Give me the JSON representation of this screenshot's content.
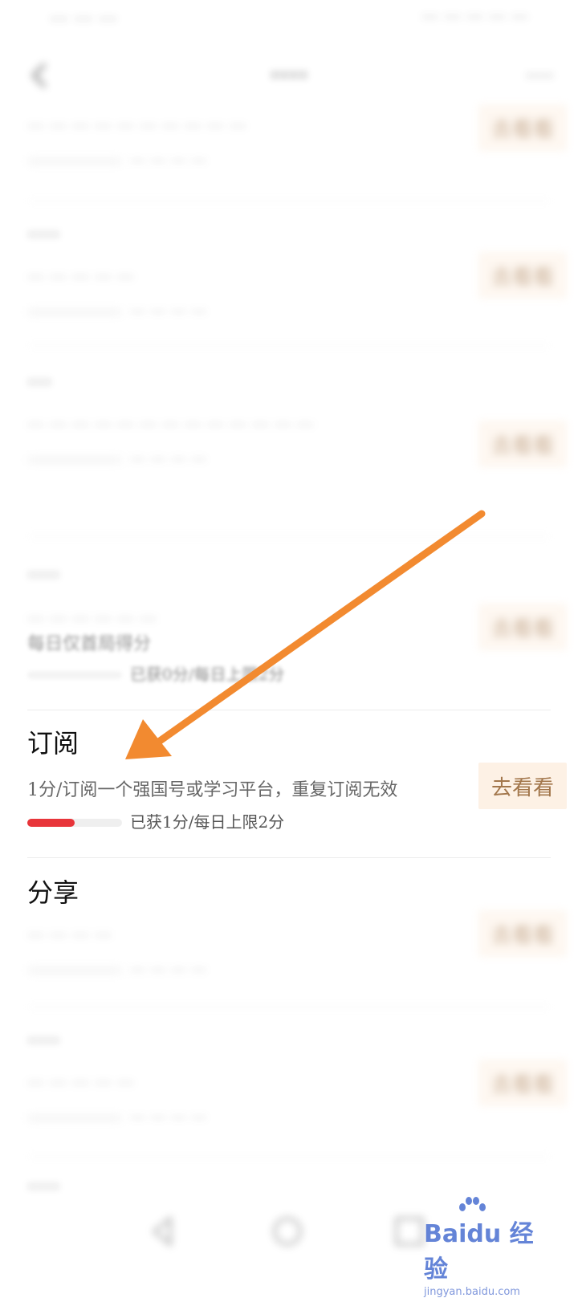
{
  "status_bar": {
    "left": "··· ··· ···",
    "right": "··· ··· ··· ··· ···"
  },
  "header": {
    "title": "····",
    "right_link": "····"
  },
  "tasks": [
    {
      "title": "",
      "desc": "··· ··· ··· ··· ··· ··· ··· ··· ··· ···",
      "progress_text": "··· ··· ··· ···",
      "button": "去看看",
      "progress": 0
    },
    {
      "title": "····",
      "desc": "··· ··· ··· ··· ···",
      "progress_text": "··· ··· ··· ···",
      "button": "去看看",
      "progress": 0
    },
    {
      "title": "···",
      "desc": "··· ··· ··· ··· ··· ··· ··· ··· ··· ··· ··· ··· ···",
      "progress_text": "··· ··· ··· ···",
      "button": "去看看",
      "progress": 0
    },
    {
      "title": "····",
      "desc_blur": "··· ··· ··· ··· ··· ···",
      "desc": "每日仅首局得分",
      "progress_text": "已获0分/每日上限2分",
      "button": "去看看",
      "progress": 0
    },
    {
      "title": "订阅",
      "desc": "1分/订阅一个强国号或学习平台，重复订阅无效",
      "progress_text": "已获1分/每日上限2分",
      "button": "去看看",
      "progress": 0.5
    },
    {
      "title": "分享",
      "desc": "··· ··· ··· ···",
      "progress_text": "··· ··· ··· ···",
      "button": "去看看",
      "progress": 0
    },
    {
      "title": "····",
      "desc": "··· ··· ··· ··· ···",
      "progress_text": "··· ··· ··· ···",
      "button": "去看看",
      "progress": 0
    },
    {
      "title": "····",
      "desc": "",
      "progress_text": "",
      "button": "",
      "progress": 0
    }
  ],
  "arrow_color": "#f28a30",
  "accent_red": "#e8353a",
  "button_bg": "#fdf1e5",
  "watermark": {
    "main": "Baidu 经验",
    "sub": "jingyan.baidu.com"
  }
}
